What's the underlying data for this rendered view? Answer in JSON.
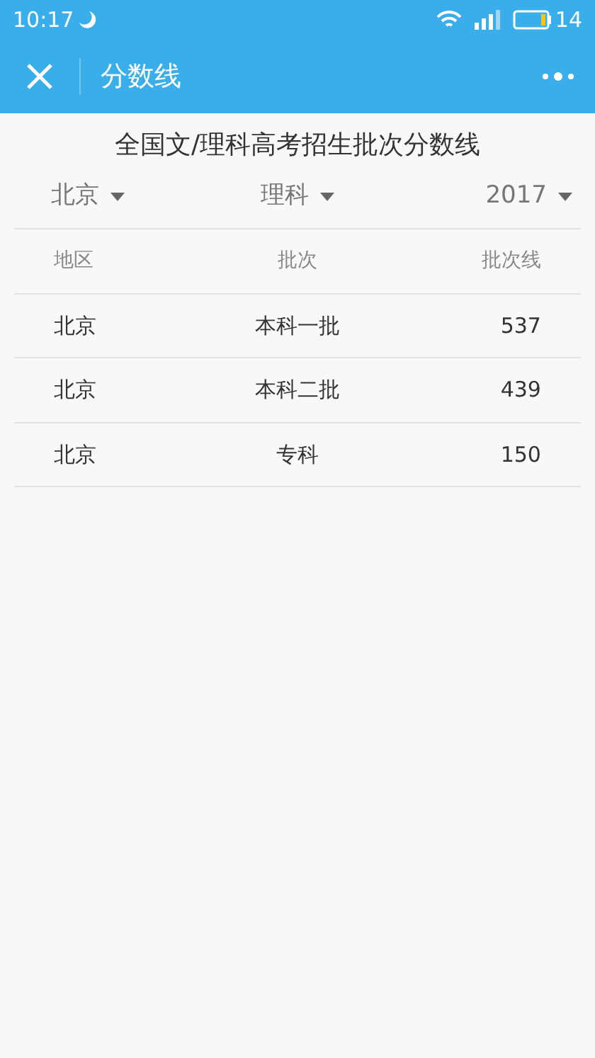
{
  "status_bar": {
    "time": "10:17",
    "battery": "14"
  },
  "app_bar": {
    "title": "分数线"
  },
  "heading": "全国文/理科高考招生批次分数线",
  "filters": [
    {
      "label": "北京"
    },
    {
      "label": "理科"
    },
    {
      "label": "2017"
    }
  ],
  "table": {
    "columns": [
      "地区",
      "批次",
      "批次线"
    ],
    "rows": [
      [
        "北京",
        "本科一批",
        "537"
      ],
      [
        "北京",
        "本科二批",
        "439"
      ],
      [
        "北京",
        "专科",
        "150"
      ]
    ]
  }
}
